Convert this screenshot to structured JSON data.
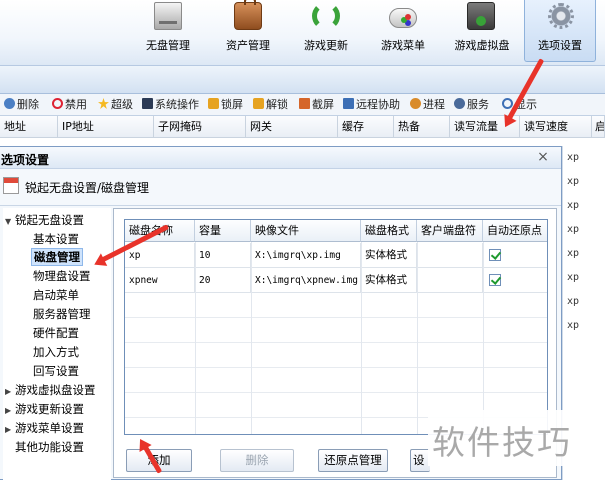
{
  "toolbar": {
    "items": [
      {
        "label": "无盘管理",
        "icon": "disk-icon"
      },
      {
        "label": "资产管理",
        "icon": "briefcase-icon"
      },
      {
        "label": "游戏更新",
        "icon": "refresh-icon"
      },
      {
        "label": "游戏菜单",
        "icon": "gamepad-icon"
      },
      {
        "label": "游戏虚拟盘",
        "icon": "virtual-disk-icon"
      },
      {
        "label": "选项设置",
        "icon": "gear-icon",
        "active": true
      }
    ]
  },
  "actions": {
    "items": [
      "删除",
      "禁用",
      "超级",
      "系统操作",
      "锁屏",
      "解锁",
      "截屏",
      "远程协助",
      "进程",
      "服务",
      "显示"
    ]
  },
  "grid": {
    "columns": [
      "地址",
      "IP地址",
      "子网掩码",
      "网关",
      "缓存",
      "热备",
      "读写流量",
      "读写速度",
      "启"
    ],
    "side_cells": [
      "xp",
      "xp",
      "xp",
      "xp",
      "xp",
      "xp",
      "xp",
      "xp"
    ]
  },
  "dialog": {
    "title": "选项设置",
    "close": "×",
    "header": "锐起无盘设置/磁盘管理",
    "tree": [
      {
        "label": "锐起无盘设置",
        "expanded": true,
        "level": 0
      },
      {
        "label": "基本设置",
        "level": 1
      },
      {
        "label": "磁盘管理",
        "level": 1,
        "selected": true
      },
      {
        "label": "物理盘设置",
        "level": 1
      },
      {
        "label": "启动菜单",
        "level": 1
      },
      {
        "label": "服务器管理",
        "level": 1
      },
      {
        "label": "硬件配置",
        "level": 1
      },
      {
        "label": "加入方式",
        "level": 1
      },
      {
        "label": "回写设置",
        "level": 1
      },
      {
        "label": "游戏虚拟盘设置",
        "expanded": false,
        "level": 0
      },
      {
        "label": "游戏更新设置",
        "expanded": false,
        "level": 0
      },
      {
        "label": "游戏菜单设置",
        "expanded": false,
        "level": 0
      },
      {
        "label": "其他功能设置",
        "level": 0
      }
    ],
    "table": {
      "columns": [
        "磁盘名称",
        "容量",
        "映像文件",
        "磁盘格式",
        "客户端盘符",
        "自动还原点"
      ],
      "rows": [
        {
          "name": "xp",
          "capacity": "10",
          "image": "X:\\imgrq\\xp.img",
          "format": "实体格式",
          "drive": "",
          "auto_restore": true
        },
        {
          "name": "xpnew",
          "capacity": "20",
          "image": "X:\\imgrq\\xpnew.img",
          "format": "实体格式",
          "drive": "",
          "auto_restore": true
        }
      ]
    },
    "buttons": {
      "add": "添加",
      "delete": "删除",
      "restore": "还原点管理",
      "partial": "设"
    }
  },
  "colors": {
    "annotation_arrow": "#e8332a",
    "selection": "#cfe3fb",
    "check": "#1f9a2e"
  },
  "watermark": "软件技巧"
}
